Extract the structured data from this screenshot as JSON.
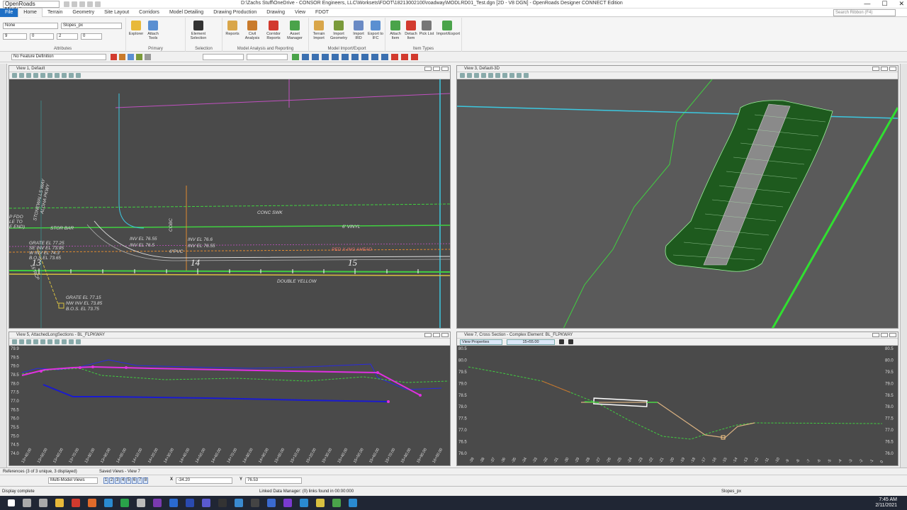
{
  "window": {
    "workflow": "OpenRoads Modeling",
    "title": "D:\\Zachs Stuff\\OneDrive - CONSOR Engineers, LLC\\Worksets\\FDOT\\18213002100\\roadway\\MODLRD01_Test.dgn [2D - V8 DGN] - OpenRoads Designer CONNECT Edition",
    "search_placeholder": "Search Ribbon (F4)"
  },
  "tabs": [
    "File",
    "Home",
    "Terrain",
    "Geometry",
    "Site Layout",
    "Corridors",
    "Model Detailing",
    "Drawing Production",
    "Drawing",
    "View",
    "FDOT"
  ],
  "active_tab": "Home",
  "ribbon": {
    "attributes": {
      "label": "Attributes",
      "level": "None",
      "style": "Slopes_px",
      "weight": "9",
      "color": "0",
      "line": "2",
      "trans": "0"
    },
    "primary": {
      "label": "Primary",
      "buttons": [
        "Explorer",
        "Attach Tools"
      ]
    },
    "selection": {
      "label": "Selection",
      "buttons": [
        "Element Selection"
      ]
    },
    "analysis": {
      "label": "Model Analysis and Reporting",
      "buttons": [
        "Reports",
        "Civil Analysis",
        "Corridor Reports",
        "Asset Manager"
      ]
    },
    "import_export": {
      "label": "Model Import/Export",
      "buttons": [
        "Terrain Import",
        "Import Geometry",
        "Import IRD",
        "Export to IFC"
      ]
    },
    "item_types": {
      "label": "Item Types",
      "buttons": [
        "Attach Item",
        "Detach Item",
        "Pick List",
        "Import/Export"
      ]
    }
  },
  "feature_definition": "No Feature Definition",
  "views": {
    "v1": {
      "title": "View 1, Default",
      "labels": {
        "grate1": "GRATE EL 77.25",
        "se_inv": "SE INV EL 73.95",
        "w_inv": "W INV EL 74.3",
        "bos1": "B.O.S EL 73.65",
        "inv1": "INV EL 76.55",
        "inv2": "INV EL 76.5",
        "inv3": "INV EL 76.6",
        "inv4": "INV EL 76.55",
        "pvc": "6\"PVC",
        "conc": "CONC SWK",
        "vinyl": "6' VINYL",
        "ped": "PED X-ING AHEAD",
        "dy": "DOUBLE YELLOW",
        "grate2": "GRATE EL 77.15",
        "nw_inv": "NW INV EL 73.85",
        "bos2": "B.O.S. EL 73.75",
        "sta13": "13",
        "sta14": "14",
        "sta15": "15",
        "road": "STONEWALLS WAY",
        "road2": "ALOHA PKWY",
        "left_cut": "P FDO",
        "left_cut2": "LE TO",
        "left_cut3": "E END)",
        "storm": "STOR BAR",
        "rcp": "15\"RCP",
        "cobc": "COBC"
      }
    },
    "v3": {
      "title": "View 3, Default-3D"
    },
    "v5": {
      "title": "View 5, AttachedLongSections - BL_FLPKWAY",
      "y_ticks": [
        "79.9",
        "79.5",
        "79.0",
        "78.5",
        "78.0",
        "77.5",
        "77.0",
        "76.5",
        "76.0",
        "75.5",
        "75.0",
        "74.5",
        "74.0"
      ],
      "x_ticks": [
        "13+40.00",
        "13+50.00",
        "13+60.00",
        "13+70.00",
        "13+80.00",
        "13+90.00",
        "14+00.00",
        "14+10.00",
        "14+20.00",
        "14+30.00",
        "14+40.00",
        "14+50.00",
        "14+60.00",
        "14+70.00",
        "14+80.00",
        "14+90.00",
        "15+00.00",
        "15+10.00",
        "15+20.00",
        "15+30.00",
        "15+40.00",
        "15+50.00",
        "15+60.00",
        "15+70.00",
        "15+80.00",
        "15+90.00",
        "16+00.00"
      ]
    },
    "v7": {
      "title": "View 7, Cross Section - Complex Element: BL_FLPKWAY",
      "properties_label": "View Properties",
      "station": "15+55.00",
      "y_ticks": [
        "80.5",
        "80.0",
        "79.5",
        "79.0",
        "78.5",
        "78.0",
        "77.5",
        "77.0",
        "76.5",
        "76.0"
      ],
      "x_ticks": [
        "-39",
        "-38",
        "-37",
        "-36",
        "-35",
        "-34",
        "-33",
        "-32",
        "-31",
        "-30",
        "-29",
        "-28",
        "-27",
        "-26",
        "-25",
        "-24",
        "-23",
        "-22",
        "-21",
        "-20",
        "-19",
        "-18",
        "-17",
        "-16",
        "-15",
        "-14",
        "-13",
        "-12",
        "-11",
        "-10",
        "-9",
        "-8",
        "-7",
        "-6",
        "-5",
        "-4",
        "-3",
        "-2",
        "-1",
        "0"
      ]
    }
  },
  "bottom_tabs": {
    "references": "References (3 of 3 unique, 3 displayed)",
    "saved_views": "Saved Views - View 7"
  },
  "coords": {
    "view_mode": "Multi-Model Views",
    "x_label": "X",
    "x_value": "-34.20",
    "y_label": "Y",
    "y_value": "76.53",
    "view_numbers": [
      "1",
      "2",
      "3",
      "4",
      "5",
      "6",
      "7",
      "8"
    ]
  },
  "status": {
    "left": "Display complete",
    "center": "Linked Data Manager: (0) links found in 00:00:000",
    "level": "Slopes_px"
  },
  "clock": {
    "time": "7:45 AM",
    "date": "2/11/2021"
  }
}
